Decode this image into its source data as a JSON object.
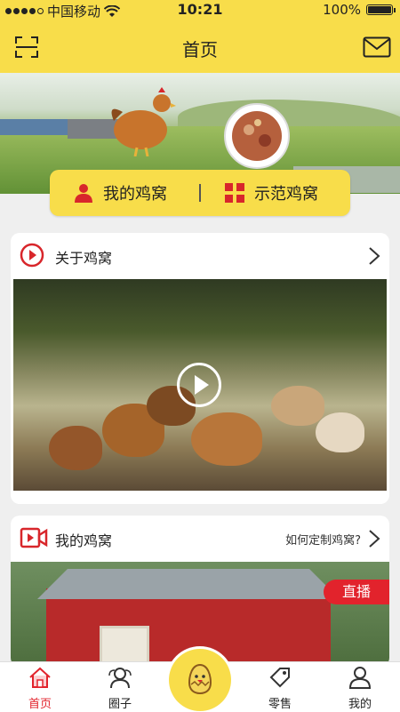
{
  "status_bar": {
    "carrier": "中国移动",
    "time": "10:21",
    "battery": "100%"
  },
  "nav": {
    "title": "首页"
  },
  "segment": {
    "left_label": "我的鸡窝",
    "right_label": "示范鸡窝"
  },
  "section1": {
    "title": "关于鸡窝"
  },
  "section2": {
    "title": "我的鸡窝",
    "link": "如何定制鸡窝?",
    "badge": "直播"
  },
  "tabbar": {
    "tabs": [
      {
        "label": "首页"
      },
      {
        "label": "圈子"
      },
      {
        "label": "零售"
      },
      {
        "label": "我的"
      }
    ]
  },
  "colors": {
    "accent": "#f8dd4a",
    "brand_red": "#e2232c"
  },
  "icons": {
    "scan": "scan-icon",
    "mail": "mail-icon",
    "play": "play-icon",
    "person": "person-icon",
    "grid": "grid-icon"
  }
}
